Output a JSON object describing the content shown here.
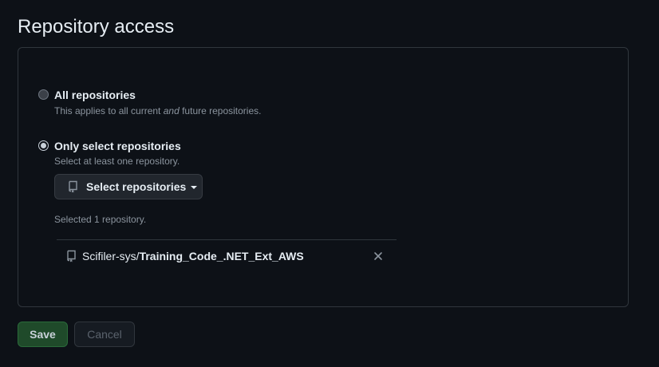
{
  "page": {
    "title": "Repository access"
  },
  "options": {
    "all": {
      "label": "All repositories",
      "desc_before": "This applies to all current ",
      "desc_em": "and",
      "desc_after": " future repositories.",
      "checked": false
    },
    "select": {
      "label": "Only select repositories",
      "desc": "Select at least one repository.",
      "checked": true
    }
  },
  "select_button": {
    "label": "Select repositories",
    "icon": "repo-icon"
  },
  "selected_summary": "Selected 1 repository.",
  "selected_repos": [
    {
      "owner": "Scifiler-sys/",
      "name": "Training_Code_.NET_Ext_AWS",
      "icon": "repo-icon",
      "remove_icon": "close-icon"
    }
  ],
  "actions": {
    "save_label": "Save",
    "cancel_label": "Cancel"
  },
  "colors": {
    "background": "#0d1117",
    "border": "#30363d",
    "save_bg": "#1f4a2a",
    "muted_text": "#8b949e"
  }
}
